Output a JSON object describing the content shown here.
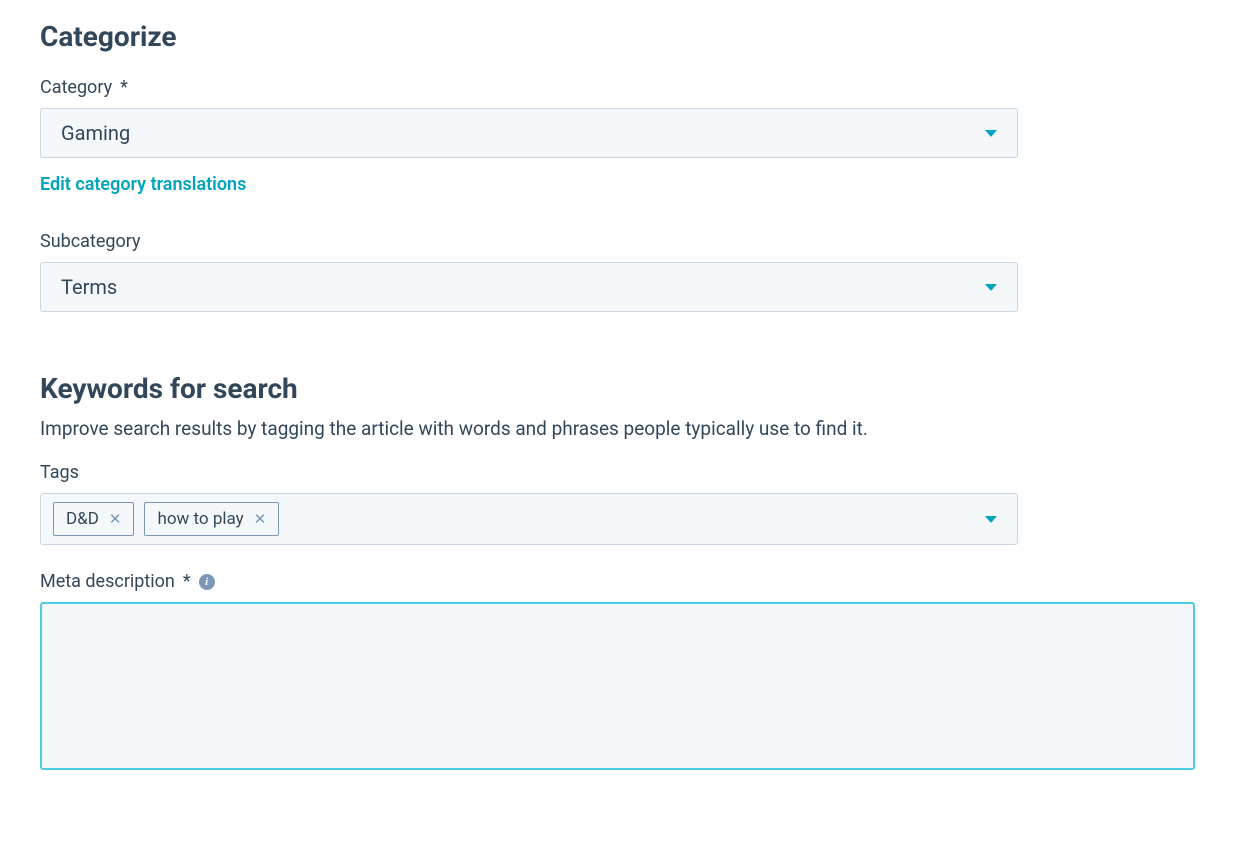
{
  "categorize": {
    "heading": "Categorize",
    "category": {
      "label": "Category",
      "required": "*",
      "value": "Gaming"
    },
    "editTranslationsLink": "Edit category translations",
    "subcategory": {
      "label": "Subcategory",
      "value": "Terms"
    }
  },
  "keywords": {
    "heading": "Keywords for search",
    "description": "Improve search results by tagging the article with words and phrases people typically use to find it.",
    "tags": {
      "label": "Tags",
      "items": [
        "D&D",
        "how to play"
      ]
    },
    "metaDescription": {
      "label": "Meta description",
      "required": "*",
      "value": ""
    }
  }
}
